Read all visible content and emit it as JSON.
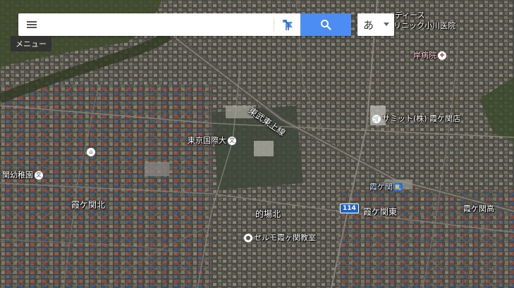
{
  "search": {
    "placeholder": "",
    "value": ""
  },
  "menu": {
    "tooltip": "メニュー"
  },
  "input_method": {
    "label": "あ"
  },
  "map": {
    "labels": {
      "clinic_line1": "ディース",
      "clinic_line2": "リニック小川医院",
      "kishi_hospital": "岸病院",
      "summit_store": "サミット(株) 霞ケ関店",
      "tobu_tojo_line": "東武東上線",
      "tokyo_kokusai_univ": "東京国際大",
      "kindergarten": "関幼稚園",
      "kasumigaseki_kita": "霞ケ関北",
      "kasumigaseki_station": "霞ケ関",
      "route_number": "114",
      "kasumigaseki_higashi": "霞ケ関東",
      "matoba_kita": "的場北",
      "kasumigaseki_high": "霞ケ関高",
      "serumo_class": "セルモ霞ヶ関教室"
    }
  },
  "colors": {
    "search_button": "#4b8df2",
    "route_badge": "#1f63c5",
    "station_icon": "#1b6fd6"
  }
}
